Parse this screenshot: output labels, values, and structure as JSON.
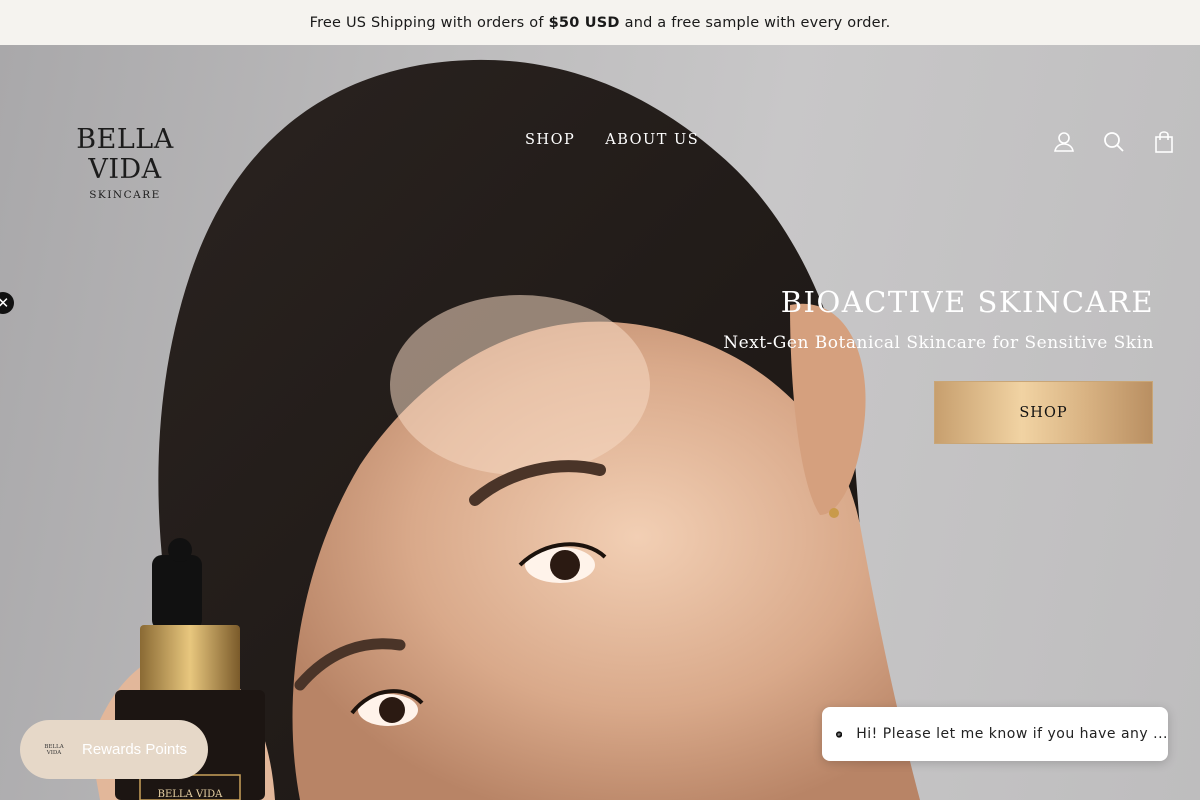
{
  "announcement": {
    "before": "Free US Shipping with orders of",
    "amount": "$50 USD",
    "after": "and a free sample with every order."
  },
  "header": {
    "logo_brand": "BELLA VIDA",
    "logo_sub": "SKINCARE",
    "nav": [
      {
        "label": "SHOP"
      },
      {
        "label": "ABOUT US"
      }
    ],
    "icons": [
      "account-icon",
      "search-icon",
      "cart-icon"
    ]
  },
  "hero": {
    "title": "BIOACTIVE SKINCARE",
    "subtitle": "Next-Gen Botanical Skincare for Sensitive Skin",
    "button_label": "SHOP",
    "bottle_label": "BELLA VIDA"
  },
  "popup_close": "✕",
  "rewards": {
    "logo_text": "BELLA VIDA",
    "label": "Rewards Points"
  },
  "chat": {
    "message": "Hi! Please let me know if you have any ..."
  },
  "colors": {
    "gold_button": "#e2c08f",
    "announcement_bg": "#f5f3ef",
    "rewards_bg": "#e6d8c8"
  }
}
